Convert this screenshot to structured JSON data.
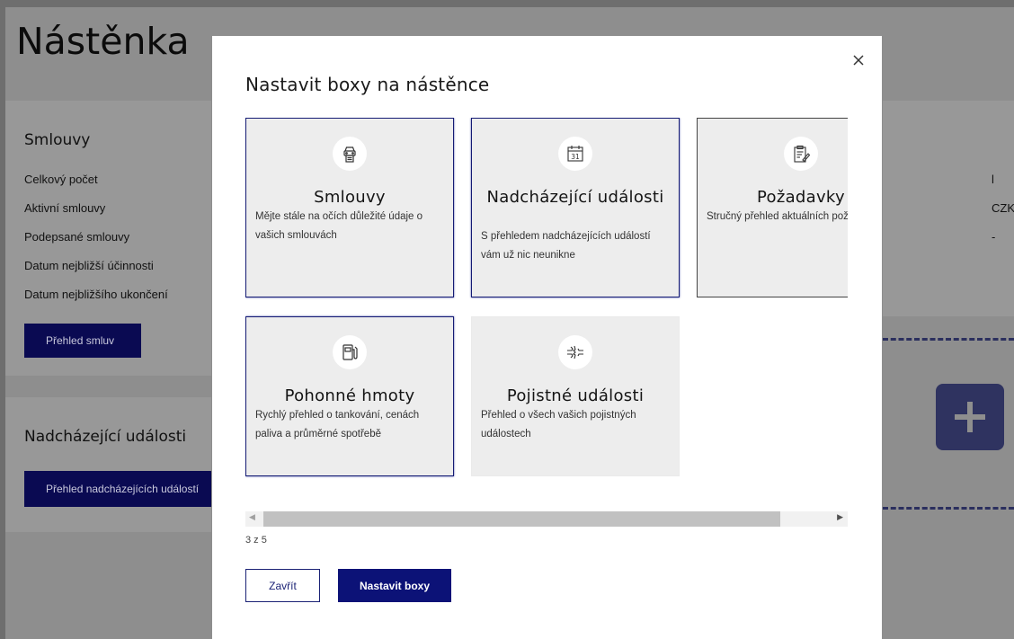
{
  "background": {
    "page_title": "Nástěnka",
    "contracts_card": {
      "title": "Smlouvy",
      "items": [
        "Celkový počet",
        "Aktivní smlouvy",
        "Podepsané smlouvy",
        "Datum nejbližší účinnosti",
        "Datum nejbližšího ukončení"
      ],
      "button": "Přehled smluv"
    },
    "events_card": {
      "title": "Nadcházející události",
      "button": "Přehled nadcházejících událostí"
    },
    "right_values": [
      "l",
      "CZK",
      "-"
    ]
  },
  "modal": {
    "title": "Nastavit boxy na nástěnce",
    "boxes": [
      {
        "title": "Smlouvy",
        "desc": "Mějte stále na očích důležité údaje o vašich smlouvách",
        "icon": "car-document-icon",
        "selected": true
      },
      {
        "title": "Nadcházející události",
        "desc": "S přehledem nadcházejících událostí vám už nic neunikne",
        "icon": "calendar-31-icon",
        "selected": true,
        "calendar_day": "31"
      },
      {
        "title": "Požadavky",
        "desc": "Stručný přehled aktuálních požadavků",
        "icon": "clipboard-pen-icon",
        "selected": false
      },
      {
        "title": "Pohonné hmoty",
        "desc": "Rychlý přehled o tankování, cenách paliva a průměrné spotřebě",
        "icon": "fuel-pump-icon",
        "selected": true
      },
      {
        "title": "Pojistné události",
        "desc": "Přehled o všech vašich pojistných událostech",
        "icon": "car-crash-icon",
        "selected": false
      }
    ],
    "counter": "3 z 5",
    "close_button": "Zavřít",
    "submit_button": "Nastavit boxy"
  },
  "colors": {
    "accent": "#0c1277",
    "box_bg": "#ededed",
    "overlay": "#8e8e8e"
  }
}
